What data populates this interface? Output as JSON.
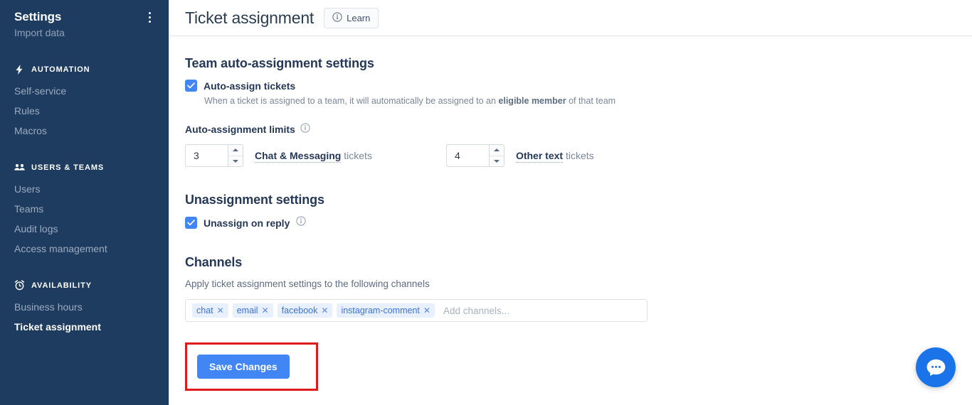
{
  "sidebar": {
    "title": "Settings",
    "menu_icon": "kebab-menu-icon",
    "cut_item": "Import data",
    "groups": [
      {
        "label": "AUTOMATION",
        "icon": "lightning-bolt-icon",
        "items": [
          {
            "label": "Self-service",
            "active": false
          },
          {
            "label": "Rules",
            "active": false
          },
          {
            "label": "Macros",
            "active": false
          }
        ]
      },
      {
        "label": "USERS & TEAMS",
        "icon": "people-group-icon",
        "items": [
          {
            "label": "Users",
            "active": false
          },
          {
            "label": "Teams",
            "active": false
          },
          {
            "label": "Audit logs",
            "active": false
          },
          {
            "label": "Access management",
            "active": false
          }
        ]
      },
      {
        "label": "AVAILABILITY",
        "icon": "alarm-clock-icon",
        "items": [
          {
            "label": "Business hours",
            "active": false
          },
          {
            "label": "Ticket assignment",
            "active": true
          }
        ]
      }
    ]
  },
  "header": {
    "title": "Ticket assignment",
    "learn_label": "Learn",
    "learn_icon": "info-circle-icon"
  },
  "team_section": {
    "title": "Team auto-assignment settings",
    "auto_assign": {
      "label": "Auto-assign tickets",
      "checked": true,
      "description_pre": "When a ticket is assigned to a team, it will automatically be assigned to an ",
      "description_bold": "eligible member",
      "description_post": " of that team"
    },
    "limits": {
      "label": "Auto-assignment limits",
      "info_icon": "info-circle-icon",
      "fields": [
        {
          "value": "3",
          "bold_label": "Chat & Messaging",
          "suffix": " tickets"
        },
        {
          "value": "4",
          "bold_label": "Other text",
          "suffix": " tickets"
        }
      ]
    }
  },
  "unassignment_section": {
    "title": "Unassignment settings",
    "unassign_on_reply": {
      "label": "Unassign on reply",
      "checked": true,
      "info_icon": "info-circle-icon"
    }
  },
  "channels_section": {
    "title": "Channels",
    "description": "Apply ticket assignment settings to the following channels",
    "tags": [
      "chat",
      "email",
      "facebook",
      "instagram-comment"
    ],
    "placeholder": "Add channels..."
  },
  "footer": {
    "save_label": "Save Changes"
  },
  "chat_widget": {
    "icon": "chat-bubble-icon"
  },
  "colors": {
    "sidebar_bg": "#1e3c60",
    "accent_blue": "#4285f4",
    "tag_bg": "#e8f0fe",
    "tag_text": "#3b72d9",
    "highlight_red": "#e01b1b",
    "chat_widget_blue": "#1a73e8"
  }
}
